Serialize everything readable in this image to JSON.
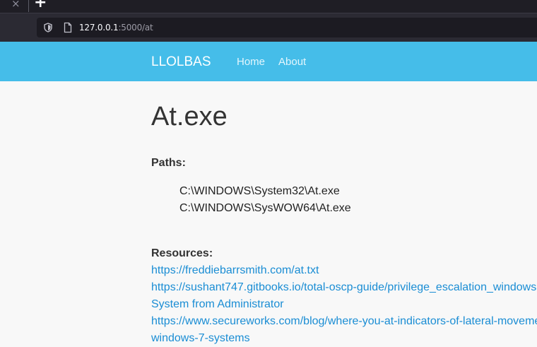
{
  "browser": {
    "url_host": "127.0.0.1",
    "url_rest": ":5000/at"
  },
  "navbar": {
    "brand": "LLOLBAS",
    "links": [
      "Home",
      "About"
    ]
  },
  "page": {
    "title": "At.exe",
    "paths_label": "Paths:",
    "paths": [
      "C:\\WINDOWS\\System32\\At.exe",
      "C:\\WINDOWS\\SysWOW64\\At.exe"
    ],
    "resources_label": "Resources:",
    "resources": [
      {
        "lines": [
          "https://freddiebarrsmith.com/at.txt"
        ]
      },
      {
        "lines": [
          "https://sushant747.gitbooks.io/total-oscp-guide/privilege_escalation_windows",
          "System from Administrator"
        ]
      },
      {
        "lines": [
          "https://www.secureworks.com/blog/where-you-at-indicators-of-lateral-moveme",
          "windows-7-systems"
        ]
      }
    ]
  }
}
